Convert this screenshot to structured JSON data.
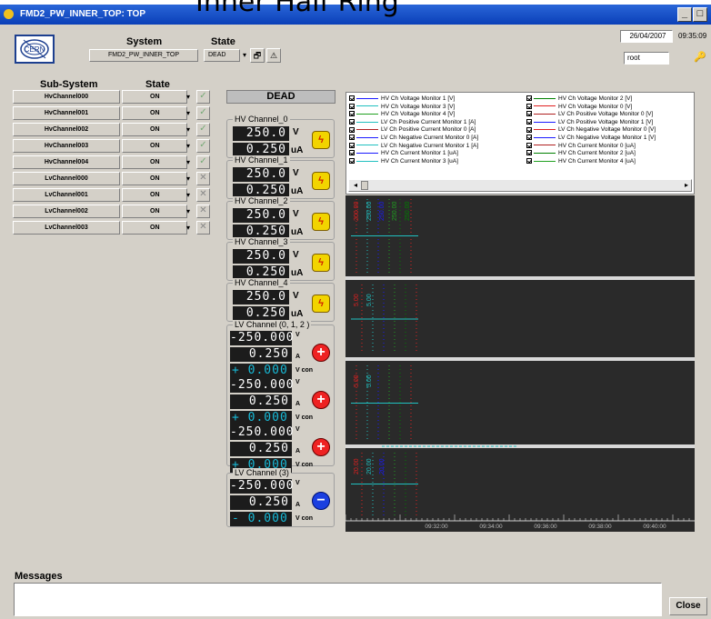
{
  "window": {
    "title": "FMD2_PW_INNER_TOP: TOP",
    "overlay_title": "Inner Half Ring",
    "min": "_",
    "max": "□",
    "close": "X"
  },
  "header": {
    "system_label": "System",
    "state_label": "State",
    "system_value": "FMD2_PW_INNER_TOP",
    "state_value": "DEAD",
    "date": "26/04/2007",
    "time": "09:35:09",
    "user": "root",
    "logo": "CERN"
  },
  "subsystems": {
    "col_sub": "Sub-System",
    "col_state": "State",
    "rows": [
      {
        "name": "HvChannel000",
        "state": "ON",
        "ok": true
      },
      {
        "name": "HvChannel001",
        "state": "ON",
        "ok": true
      },
      {
        "name": "HvChannel002",
        "state": "ON",
        "ok": true
      },
      {
        "name": "HvChannel003",
        "state": "ON",
        "ok": true
      },
      {
        "name": "HvChannel004",
        "state": "ON",
        "ok": true
      },
      {
        "name": "LvChannel000",
        "state": "ON",
        "ok": false
      },
      {
        "name": "LvChannel001",
        "state": "ON",
        "ok": false
      },
      {
        "name": "LvChannel002",
        "state": "ON",
        "ok": false
      },
      {
        "name": "LvChannel003",
        "state": "ON",
        "ok": false
      }
    ]
  },
  "status_banner": "DEAD",
  "hv_channels": [
    {
      "label": "HV Channel_0",
      "voltage": "250.0",
      "v_unit": "V",
      "current": "0.250",
      "i_unit": "uA"
    },
    {
      "label": "HV Channel_1",
      "voltage": "250.0",
      "v_unit": "V",
      "current": "0.250",
      "i_unit": "uA"
    },
    {
      "label": "HV Channel_2",
      "voltage": "250.0",
      "v_unit": "V",
      "current": "0.250",
      "i_unit": "uA"
    },
    {
      "label": "HV Channel_3",
      "voltage": "250.0",
      "v_unit": "V",
      "current": "0.250",
      "i_unit": "uA"
    },
    {
      "label": "HV Channel_4",
      "voltage": "250.0",
      "v_unit": "V",
      "current": "0.250",
      "i_unit": "uA"
    }
  ],
  "lv_group_a": {
    "label": "LV Channel (0, 1, 2 )",
    "rows": [
      {
        "voltage": "-250.000",
        "v_unit": "V",
        "current": "0.250",
        "i_unit": "A",
        "con": "+ 0.000",
        "con_unit": "V con",
        "btn": "+"
      },
      {
        "voltage": "-250.000",
        "v_unit": "V",
        "current": "0.250",
        "i_unit": "A",
        "con": "+ 0.000",
        "con_unit": "V con",
        "btn": "+"
      },
      {
        "voltage": "-250.000",
        "v_unit": "V",
        "current": "0.250",
        "i_unit": "A",
        "con": "+ 0.000",
        "con_unit": "V con",
        "btn": "+"
      }
    ]
  },
  "lv_group_b": {
    "label": "LV Channel (3)",
    "rows": [
      {
        "voltage": "-250.000",
        "v_unit": "V",
        "current": "0.250",
        "i_unit": "A",
        "con": "- 0.000",
        "con_unit": "V con",
        "btn": "−"
      }
    ]
  },
  "legend": {
    "items": [
      {
        "label": "HV Ch Voltage Monitor 1 [V]",
        "color": "#1a1aff"
      },
      {
        "label": "HV Ch Voltage Monitor 2 [V]",
        "color": "#008000"
      },
      {
        "label": "HV Ch Voltage Monitor 3 [V]",
        "color": "#20c0c0"
      },
      {
        "label": "HV Ch Voltage Monitor 0 [V]",
        "color": "#e02020"
      },
      {
        "label": "HV Ch Voltage Monitor 4 [V]",
        "color": "#20a020"
      },
      {
        "label": "LV Ch Positive Voltage Monitor 0 [V]",
        "color": "#b02020"
      },
      {
        "label": "LV Ch Positive Current Monitor 1 [A]",
        "color": "#20c0c0"
      },
      {
        "label": "LV Ch Positive Voltage Monitor 1 [V]",
        "color": "#1a1aff"
      },
      {
        "label": "LV Ch Positive Current Monitor 0 [A]",
        "color": "#b02020"
      },
      {
        "label": "LV Ch Negative Voltage Monitor 0 [V]",
        "color": "#e02020"
      },
      {
        "label": "LV Ch Negative Current Monitor 0 [A]",
        "color": "#1a1aff"
      },
      {
        "label": "LV Ch Negative Voltage Monitor 1 [V]",
        "color": "#1a1aff"
      },
      {
        "label": "LV Ch Negative Current Monitor 1 [A]",
        "color": "#20c0c0"
      },
      {
        "label": "HV Ch Current Monitor 0 [uA]",
        "color": "#b02020"
      },
      {
        "label": "HV Ch Current Monitor 1 [uA]",
        "color": "#1a1aff"
      },
      {
        "label": "HV Ch Current Monitor 2 [uA]",
        "color": "#008000"
      },
      {
        "label": "HV Ch Current Monitor 3 [uA]",
        "color": "#20c0c0"
      },
      {
        "label": "HV Ch Current Monitor 4 [uA]",
        "color": "#20a020"
      }
    ]
  },
  "trend": {
    "time_labels": [
      "09:32:00",
      "09:34:00",
      "09:36:00",
      "09:38:00",
      "09:40:00"
    ],
    "panel_labels": [
      [
        "200.00",
        "250.00",
        "250.00",
        "250.00",
        "250.00"
      ],
      [
        "5.00",
        "5.00"
      ],
      [
        "5.00",
        "5.00"
      ],
      [
        "20.00",
        "20.00",
        "20.00"
      ]
    ],
    "colors": {
      "bg": "#2a2a2a",
      "sep": "#d8d8d8"
    }
  },
  "messages": {
    "label": "Messages"
  },
  "close_label": "Close"
}
